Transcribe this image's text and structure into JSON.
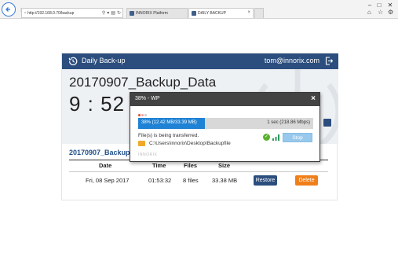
{
  "browser": {
    "address": "http://192.168.0.70/backup",
    "tabs": [
      {
        "label": "INNORIX Platform"
      },
      {
        "label": "DAILY BACKUP"
      }
    ]
  },
  "header": {
    "title": "Daily Back-up",
    "user": "tom@innorix.com"
  },
  "hero": {
    "title": "20170907_Backup_Data",
    "time": "9 : 52"
  },
  "backup_list": {
    "title": "20170907_Backup_Da",
    "columns": [
      "Date",
      "Time",
      "Files",
      "Size"
    ],
    "rows": [
      {
        "date": "Fri, 08 Sep 2017",
        "time": "01:53:32",
        "files": "8 files",
        "size": "33.38 MB",
        "restore": "Restore",
        "delete": "Delete"
      }
    ]
  },
  "dialog": {
    "title": "38% - WP",
    "progress_percent": 38,
    "progress_text": "38% (12.42 MB/33.39 MB)",
    "eta_text": "1 sec (218.86 Mbps)",
    "status": "File(s) is being transferred.",
    "path": "C:\\Users\\innorix\\Desktop\\Backupfile",
    "stop_label": "Stop",
    "brand": "INNORIX"
  },
  "colors": {
    "header_bg": "#2c4e7e",
    "progress": "#1f82d4",
    "delete": "#f07f1a",
    "restore": "#2c4e7e"
  }
}
